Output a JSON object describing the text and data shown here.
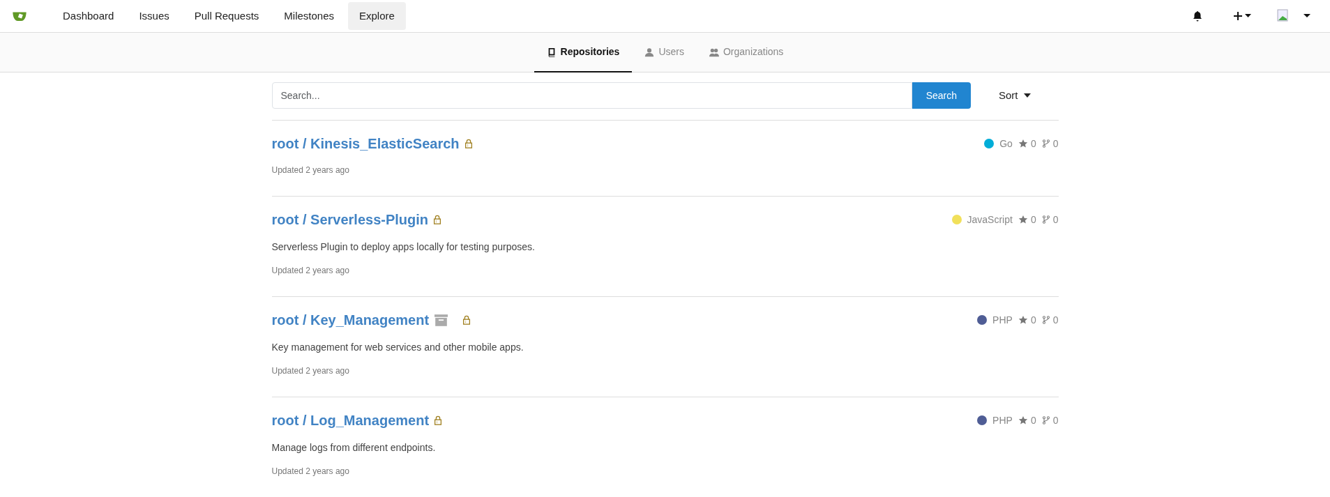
{
  "navbar": {
    "items": [
      {
        "label": "Dashboard",
        "selected": false
      },
      {
        "label": "Issues",
        "selected": false
      },
      {
        "label": "Pull Requests",
        "selected": false
      },
      {
        "label": "Milestones",
        "selected": false
      },
      {
        "label": "Explore",
        "selected": true
      }
    ]
  },
  "explore_tabs": [
    {
      "label": "Repositories",
      "kind": "repo",
      "selected": true
    },
    {
      "label": "Users",
      "kind": "user",
      "selected": false
    },
    {
      "label": "Organizations",
      "kind": "org",
      "selected": false
    }
  ],
  "search": {
    "placeholder": "Search...",
    "button": "Search",
    "sort": "Sort"
  },
  "repos": [
    {
      "title": "root / Kinesis_ElasticSearch",
      "archived": false,
      "private": true,
      "language": "Go",
      "color": "#00add8",
      "stars": "0",
      "forks": "0",
      "updated": "Updated 2 years ago"
    },
    {
      "title": "root / Serverless-Plugin",
      "archived": false,
      "private": true,
      "language": "JavaScript",
      "color": "#f1e05a",
      "stars": "0",
      "forks": "0",
      "description": "Serverless Plugin to deploy apps locally for testing purposes.",
      "updated": "Updated 2 years ago"
    },
    {
      "title": "root / Key_Management",
      "archived": true,
      "private": true,
      "language": "PHP",
      "color": "#4f5d95",
      "stars": "0",
      "forks": "0",
      "description": "Key management for web services and other mobile apps.",
      "updated": "Updated 2 years ago"
    },
    {
      "title": "root / Log_Management",
      "archived": false,
      "private": true,
      "language": "PHP",
      "color": "#4f5d95",
      "stars": "0",
      "forks": "0",
      "description": "Manage logs from different endpoints.",
      "updated": "Updated 2 years ago"
    }
  ]
}
